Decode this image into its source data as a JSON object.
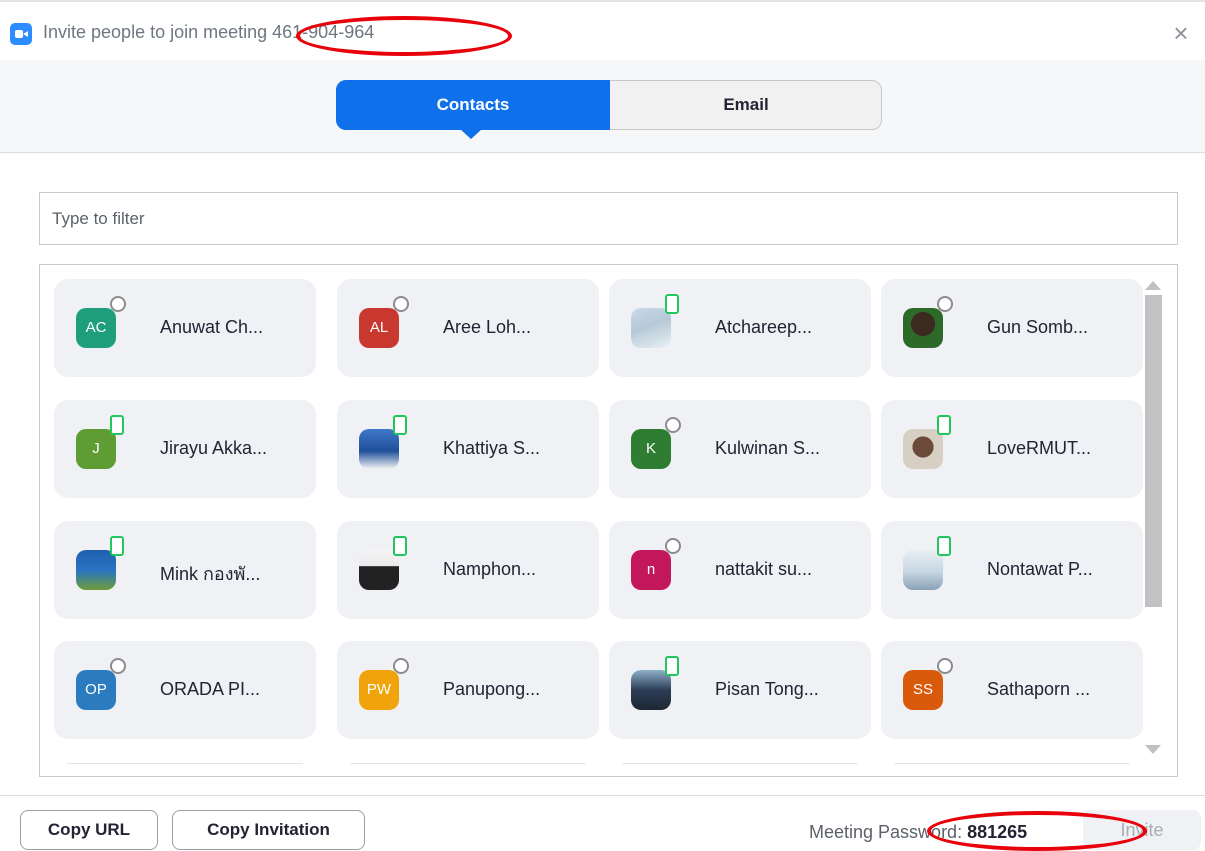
{
  "window": {
    "title": "Invite people to join meeting 461-904-964",
    "close_glyph": "×"
  },
  "tabs": [
    {
      "label": "Contacts",
      "selected": true
    },
    {
      "label": "Email",
      "selected": false
    }
  ],
  "filter": {
    "placeholder": "Type to filter",
    "value": ""
  },
  "contacts": [
    {
      "name": "Anuwat Ch...",
      "initials": "AC",
      "avatar_color": "#1e9e7a",
      "status": "offline"
    },
    {
      "name": "Aree Loh...",
      "initials": "AL",
      "avatar_color": "#c9382f",
      "status": "offline"
    },
    {
      "name": "Atchareep...",
      "initials": "",
      "avatar_color": "#c7d9ea",
      "status": "online"
    },
    {
      "name": "Gun Somb...",
      "initials": "",
      "avatar_color": "#2d6a2a",
      "status": "offline"
    },
    {
      "name": "Jirayu Akka...",
      "initials": "J",
      "avatar_color": "#5f9c34",
      "status": "online"
    },
    {
      "name": "Khattiya S...",
      "initials": "",
      "avatar_color": "#3f78c9",
      "status": "online"
    },
    {
      "name": "Kulwinan S...",
      "initials": "K",
      "avatar_color": "#2f7d32",
      "status": "offline"
    },
    {
      "name": "LoveRMUT...",
      "initials": "",
      "avatar_color": "#d8cfc4",
      "status": "online"
    },
    {
      "name": "Mink กองพั...",
      "initials": "",
      "avatar_color": "#2a73c2",
      "status": "online"
    },
    {
      "name": "Namphon...",
      "initials": "",
      "avatar_color": "#222222",
      "status": "online"
    },
    {
      "name": "nattakit su...",
      "initials": "n",
      "avatar_color": "#c2185b",
      "status": "offline"
    },
    {
      "name": "Nontawat P...",
      "initials": "",
      "avatar_color": "#c6d6e3",
      "status": "online"
    },
    {
      "name": "ORADA PI...",
      "initials": "OP",
      "avatar_color": "#2b7bbf",
      "status": "offline"
    },
    {
      "name": "Panupong...",
      "initials": "PW",
      "avatar_color": "#f0a30a",
      "status": "offline"
    },
    {
      "name": "Pisan Tong...",
      "initials": "",
      "avatar_color": "#2d3e58",
      "status": "online"
    },
    {
      "name": "Sathaporn ...",
      "initials": "SS",
      "avatar_color": "#d95a0b",
      "status": "offline"
    }
  ],
  "footer": {
    "copy_url_label": "Copy URL",
    "copy_invitation_label": "Copy Invitation",
    "password_label": "Meeting Password: ",
    "password_value": "881265",
    "invite_label": "Invite"
  },
  "annotation_color": "#e8000b"
}
